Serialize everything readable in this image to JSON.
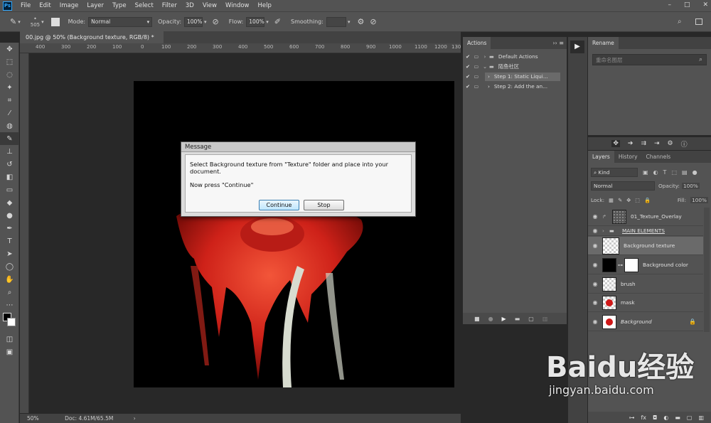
{
  "menubar": {
    "logo": "Ps",
    "items": [
      "File",
      "Edit",
      "Image",
      "Layer",
      "Type",
      "Select",
      "Filter",
      "3D",
      "View",
      "Window",
      "Help"
    ],
    "window_controls": [
      "–",
      "□",
      "✕"
    ]
  },
  "options": {
    "brush_size": "505",
    "mode_label": "Mode:",
    "mode_value": "Normal",
    "opacity_label": "Opacity:",
    "opacity_value": "100%",
    "flow_label": "Flow:",
    "flow_value": "100%",
    "smoothing_label": "Smoothing:"
  },
  "document": {
    "tab_title": "00.jpg @ 50% (Background texture, RGB/8) *",
    "tab_close": "×",
    "ruler_h": [
      "400",
      "300",
      "200",
      "100",
      "0",
      "100",
      "200",
      "300",
      "400",
      "500",
      "600",
      "700",
      "800",
      "900",
      "1000",
      "1100",
      "1200",
      "130"
    ],
    "status_zoom": "50%",
    "status_doc": "Doc: 4.61M/65.5M"
  },
  "dialog": {
    "title": "Message",
    "line1": "Select Background texture from \"Texture\" folder and place into your document.",
    "line2": "Now press \"Continue\"",
    "continue_label": "Continue",
    "stop_label": "Stop"
  },
  "actions_panel": {
    "tab": "Actions",
    "rows": [
      {
        "label": "Default Actions",
        "kind": "folder",
        "indent": 0
      },
      {
        "label": "陌鱼社区",
        "kind": "folder",
        "indent": 0
      },
      {
        "label": "Step 1: Static Liqui...",
        "kind": "step",
        "indent": 1
      },
      {
        "label": "Step 2: Add the an...",
        "kind": "step",
        "indent": 1
      }
    ]
  },
  "rename_panel": {
    "tab": "Rename",
    "placeholder": "重命名图层"
  },
  "layers_panel": {
    "tabs": [
      "Layers",
      "History",
      "Channels"
    ],
    "kind_label": "Kind",
    "blend_mode": "Normal",
    "opacity_label": "Opacity:",
    "opacity_value": "100%",
    "lock_label": "Lock:",
    "fill_label": "Fill:",
    "fill_value": "100%",
    "layers": [
      {
        "name": "01_Texture_Overlay",
        "thumb": "texture"
      },
      {
        "name": "MAIN ELEMENTS",
        "thumb": "folder"
      },
      {
        "name": "Background texture",
        "thumb": "checker"
      },
      {
        "name": "Background color",
        "thumb": "black"
      },
      {
        "name": "brush",
        "thumb": "checker"
      },
      {
        "name": "mask",
        "thumb": "mask"
      },
      {
        "name": "Background",
        "thumb": "flower"
      }
    ]
  },
  "watermark": {
    "text": "Baidu经验",
    "url": "jingyan.baidu.com"
  }
}
